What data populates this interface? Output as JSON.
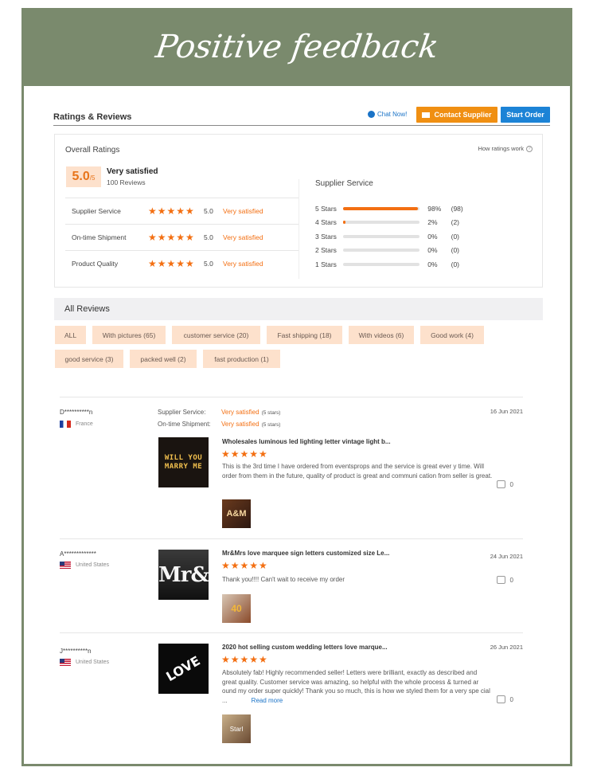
{
  "banner": {
    "title": "Positive feedback"
  },
  "header": {
    "title": "Ratings & Reviews",
    "chat_label": "Chat Now!",
    "contact_label": "Contact Supplier",
    "start_label": "Start Order"
  },
  "overall": {
    "label": "Overall Ratings",
    "how_label": "How ratings work",
    "score": "5.0",
    "score_max": "/5",
    "verdict": "Very satisfied",
    "reviews": "100 Reviews",
    "sub": [
      {
        "name": "Supplier Service",
        "score": "5.0",
        "text": "Very satisfied",
        "stars": 5
      },
      {
        "name": "On-time Shipment",
        "score": "5.0",
        "text": "Very satisfied",
        "stars": 5
      },
      {
        "name": "Product Quality",
        "score": "5.0",
        "text": "Very satisfied",
        "stars": 5
      }
    ]
  },
  "supplier_service": {
    "label": "Supplier Service",
    "bars": [
      {
        "label": "5 Stars",
        "pct_text": "98%",
        "count": "(98)",
        "fraction": 0.98
      },
      {
        "label": "4 Stars",
        "pct_text": "2%",
        "count": "(2)",
        "fraction": 0.02
      },
      {
        "label": "3 Stars",
        "pct_text": "0%",
        "count": "(0)",
        "fraction": 0
      },
      {
        "label": "2 Stars",
        "pct_text": "0%",
        "count": "(0)",
        "fraction": 0
      },
      {
        "label": "1 Stars",
        "pct_text": "0%",
        "count": "(0)",
        "fraction": 0
      }
    ]
  },
  "all_reviews": {
    "label": "All Reviews",
    "tags": [
      "ALL",
      "With pictures (65)",
      "customer service (20)",
      "Fast shipping (18)",
      "With videos (6)",
      "Good work (4)",
      "good service (3)",
      "packed well (2)",
      "fast production (1)"
    ]
  },
  "reviews": [
    {
      "name": "D**********n",
      "country": "France",
      "meta1_key": "Supplier Service:",
      "meta1_val": "Very satisfied",
      "meta1_stars": "(5 stars)",
      "meta2_key": "On-time Shipment:",
      "meta2_val": "Very satisfied",
      "meta2_stars": "(5 stars)",
      "date": "16 Jun 2021",
      "product": "Wholesales luminous led lighting letter vintage light b...",
      "text": "This is the 3rd time I have ordered from eventsprops and the service is great ever y time. Will order from them in the future, quality of product is great and communi cation from seller is great.",
      "likes": "0",
      "thumb_text_1": "WILL YOU",
      "thumb_text_2": "MARRY ME",
      "photo_text": "A&M"
    },
    {
      "name": "A*************",
      "country": "United States",
      "date": "24 Jun 2021",
      "product": "Mr&Mrs love marquee sign letters customized size Le...",
      "text": "Thank you!!!! Can't wait to receive my order",
      "likes": "0",
      "thumb_text": "Mr&",
      "photo_text": "40"
    },
    {
      "name": "J**********n",
      "country": "United States",
      "date": "26 Jun 2021",
      "product": "2020 hot selling custom wedding letters love marque...",
      "text": "Absolutely fab! Highly recommended seller! Letters were brilliant, exactly as described and great quality. Customer service was amazing, so helpful with the whole process & turned ar ound my order super quickly! Thank you so much, this is how we styled them for a very spe cial ...",
      "read_more": "Read more",
      "likes": "0",
      "thumb_text": "LOVE",
      "photo_text": "Starl"
    }
  ],
  "colors": {
    "banner": "#7a8a6d",
    "accent": "#f36f12",
    "link": "#1a73c7",
    "tag_bg": "#fde1cc"
  }
}
